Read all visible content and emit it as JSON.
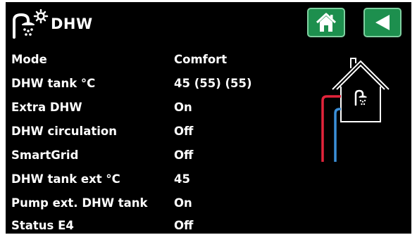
{
  "header": {
    "title": "DHW",
    "title_icon": "dhw-shower-sun-icon",
    "home_icon": "home-icon",
    "back_icon": "back-arrow-icon"
  },
  "rows": [
    {
      "label": "Mode",
      "value": "Comfort"
    },
    {
      "label": "DHW tank °C",
      "value": "45 (55)  (55)"
    },
    {
      "label": "Extra DHW",
      "value": "On"
    },
    {
      "label": "DHW circulation",
      "value": "Off"
    },
    {
      "label": "SmartGrid",
      "value": "Off"
    },
    {
      "label": "DHW tank ext °C",
      "value": "45"
    },
    {
      "label": "Pump ext. DHW tank",
      "value": "On"
    },
    {
      "label": "Status E4",
      "value": "Off"
    }
  ],
  "diagram": {
    "icon": "house-dhw-icon",
    "hot_pipe_color": "#e3243b",
    "cold_pipe_color": "#3b8fd8"
  },
  "colors": {
    "background": "#000000",
    "button": "#1d8f4e",
    "text": "#ffffff"
  }
}
